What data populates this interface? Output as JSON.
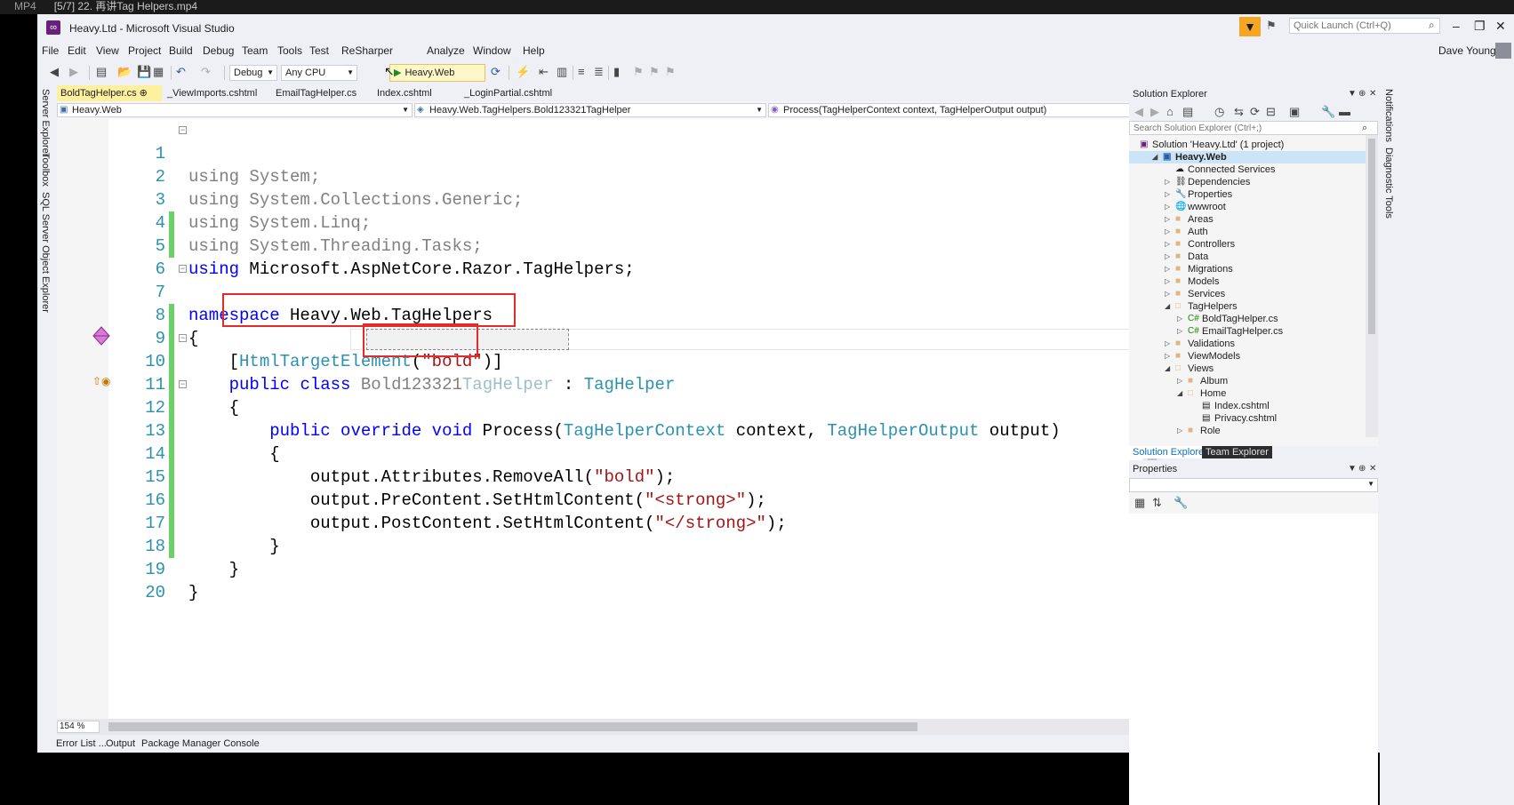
{
  "player": {
    "format": "MP4",
    "title": "[5/7] 22. 再讲Tag Helpers.mp4"
  },
  "window": {
    "title": "Heavy.Ltd - Microsoft Visual Studio"
  },
  "quick_launch": {
    "placeholder": "Quick Launch (Ctrl+Q)"
  },
  "menu": [
    "File",
    "Edit",
    "View",
    "Project",
    "Build",
    "Debug",
    "Team",
    "Tools",
    "Test",
    "ReSharper",
    "Analyze",
    "Window",
    "Help"
  ],
  "user": {
    "name": "Dave Young"
  },
  "toolbar": {
    "config": "Debug",
    "platform": "Any CPU",
    "run_target": "Heavy.Web"
  },
  "left_tools": [
    "Server Explorer",
    "Toolbox",
    "SQL Server Object Explorer"
  ],
  "right_tools": [
    "Notifications",
    "Diagnostic Tools"
  ],
  "doc_tabs": [
    {
      "label": "BoldTagHelper.cs",
      "active": true
    },
    {
      "label": "_ViewImports.cshtml",
      "active": false
    },
    {
      "label": "EmailTagHelper.cs",
      "active": false
    },
    {
      "label": "Index.cshtml",
      "active": false
    },
    {
      "label": "_LoginPartial.cshtml",
      "active": false
    }
  ],
  "nav": {
    "project": "Heavy.Web",
    "type": "Heavy.Web.TagHelpers.Bold123321TagHelper",
    "member": "Process(TagHelperContext context, TagHelperOutput output)"
  },
  "code": {
    "line_numbers": [
      "1",
      "2",
      "3",
      "4",
      "5",
      "6",
      "7",
      "8",
      "9",
      "10",
      "11",
      "12",
      "13",
      "14",
      "15",
      "16",
      "17",
      "18",
      "19",
      "20"
    ],
    "l1": {
      "kw": "using",
      "rest": " System;"
    },
    "l2": {
      "kw": "using",
      "rest": " System.Collections.Generic;"
    },
    "l3": {
      "kw": "using",
      "rest": " System.Linq;"
    },
    "l4": {
      "kw": "using",
      "rest": " System.Threading.Tasks;"
    },
    "l5": {
      "kw": "using",
      "rest": " Microsoft.AspNetCore.Razor.TagHelpers;"
    },
    "l7": {
      "kw": "namespace",
      "rest": " Heavy.Web.TagHelpers"
    },
    "l8": "{",
    "l9": {
      "open": "[",
      "attr": "HtmlTargetElement",
      "p1": "(",
      "str": "\"bold\"",
      "close": ")]"
    },
    "l10": {
      "kw1": "public",
      "kw2": "class",
      "name1": "Bold123321",
      "name2": "TagHelper",
      "colon": " : ",
      "base": "TagHelper"
    },
    "l11": "{",
    "l12": {
      "kw1": "public",
      "kw2": "override",
      "kw3": "void",
      "method": " Process(",
      "t1": "TagHelperContext",
      "a1": " context, ",
      "t2": "TagHelperOutput",
      "a2": " output)"
    },
    "l13": "{",
    "l14": {
      "pre": "output.Attributes.RemoveAll(",
      "str": "\"bold\"",
      "post": ");"
    },
    "l15": {
      "pre": "output.PreContent.SetHtmlContent(",
      "str": "\"<strong>\"",
      "post": ");"
    },
    "l16": {
      "pre": "output.PostContent.SetHtmlContent(",
      "str": "\"</strong>\"",
      "post": ");"
    },
    "l17": "}",
    "l18": "}",
    "l19": "}"
  },
  "zoom": "154 %",
  "bottom_tabs": [
    "Error List ...",
    "Output",
    "Package Manager Console"
  ],
  "solution_explorer": {
    "title": "Solution Explorer",
    "search_placeholder": "Search Solution Explorer (Ctrl+;)",
    "items": [
      {
        "label": "Solution 'Heavy.Ltd' (1 project)",
        "depth": 0,
        "icon": "solution-icon"
      },
      {
        "label": "Heavy.Web",
        "depth": 1,
        "icon": "web-project-icon",
        "selected": true
      },
      {
        "label": "Connected Services",
        "depth": 2,
        "icon": "cloud-icon"
      },
      {
        "label": "Dependencies",
        "depth": 2,
        "icon": "dependencies-icon"
      },
      {
        "label": "Properties",
        "depth": 2,
        "icon": "wrench-icon"
      },
      {
        "label": "wwwroot",
        "depth": 2,
        "icon": "globe-icon"
      },
      {
        "label": "Areas",
        "depth": 2,
        "icon": "folder-icon"
      },
      {
        "label": "Auth",
        "depth": 2,
        "icon": "folder-icon"
      },
      {
        "label": "Controllers",
        "depth": 2,
        "icon": "folder-icon"
      },
      {
        "label": "Data",
        "depth": 2,
        "icon": "folder-icon"
      },
      {
        "label": "Migrations",
        "depth": 2,
        "icon": "folder-icon"
      },
      {
        "label": "Models",
        "depth": 2,
        "icon": "folder-icon"
      },
      {
        "label": "Services",
        "depth": 2,
        "icon": "folder-icon"
      },
      {
        "label": "TagHelpers",
        "depth": 2,
        "icon": "folder-open-icon"
      },
      {
        "label": "BoldTagHelper.cs",
        "depth": 3,
        "icon": "csharp-file-icon"
      },
      {
        "label": "EmailTagHelper.cs",
        "depth": 3,
        "icon": "csharp-file-icon"
      },
      {
        "label": "Validations",
        "depth": 2,
        "icon": "folder-icon"
      },
      {
        "label": "ViewModels",
        "depth": 2,
        "icon": "folder-icon"
      },
      {
        "label": "Views",
        "depth": 2,
        "icon": "folder-open-icon"
      },
      {
        "label": "Album",
        "depth": 3,
        "icon": "folder-icon"
      },
      {
        "label": "Home",
        "depth": 3,
        "icon": "folder-open-icon"
      },
      {
        "label": "Index.cshtml",
        "depth": 4,
        "icon": "cshtml-file-icon"
      },
      {
        "label": "Privacy.cshtml",
        "depth": 4,
        "icon": "cshtml-file-icon"
      },
      {
        "label": "Role",
        "depth": 3,
        "icon": "folder-icon"
      }
    ],
    "tabs": [
      "Solution Explorer",
      "Team Explorer"
    ]
  },
  "properties": {
    "title": "Properties"
  }
}
